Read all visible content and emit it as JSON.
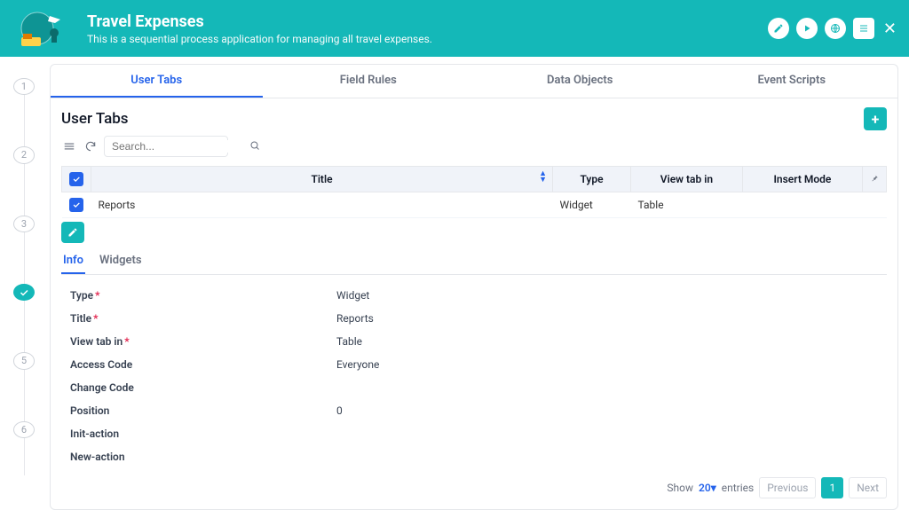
{
  "header": {
    "title": "Travel Expenses",
    "subtitle": "This is a sequential process application for managing all travel expenses."
  },
  "stepper": {
    "steps": [
      "1",
      "2",
      "3",
      "✓",
      "5",
      "6"
    ],
    "active_index": 3
  },
  "tabs": {
    "items": [
      "User Tabs",
      "Field Rules",
      "Data Objects",
      "Event Scripts"
    ],
    "active_index": 0
  },
  "panel": {
    "title": "User Tabs",
    "search_placeholder": "Search...",
    "table": {
      "headers": {
        "check": "",
        "title": "Title",
        "type": "Type",
        "view": "View tab in",
        "mode": "Insert Mode",
        "pin": ""
      },
      "rows": [
        {
          "title": "Reports",
          "type": "Widget",
          "view": "Table",
          "mode": ""
        }
      ]
    },
    "subtabs": {
      "items": [
        "Info",
        "Widgets"
      ],
      "active_index": 0
    },
    "info": [
      {
        "label": "Type",
        "required": true,
        "value": "Widget"
      },
      {
        "label": "Title",
        "required": true,
        "value": "Reports"
      },
      {
        "label": "View tab in",
        "required": true,
        "value": "Table"
      },
      {
        "label": "Access Code",
        "required": false,
        "value": "Everyone"
      },
      {
        "label": "Change Code",
        "required": false,
        "value": ""
      },
      {
        "label": "Position",
        "required": false,
        "value": "0"
      },
      {
        "label": "Init-action",
        "required": false,
        "value": ""
      },
      {
        "label": "New-action",
        "required": false,
        "value": ""
      }
    ],
    "footer": {
      "show": "Show",
      "count": "20",
      "entries": "entries",
      "prev": "Previous",
      "page": "1",
      "next": "Next"
    }
  }
}
